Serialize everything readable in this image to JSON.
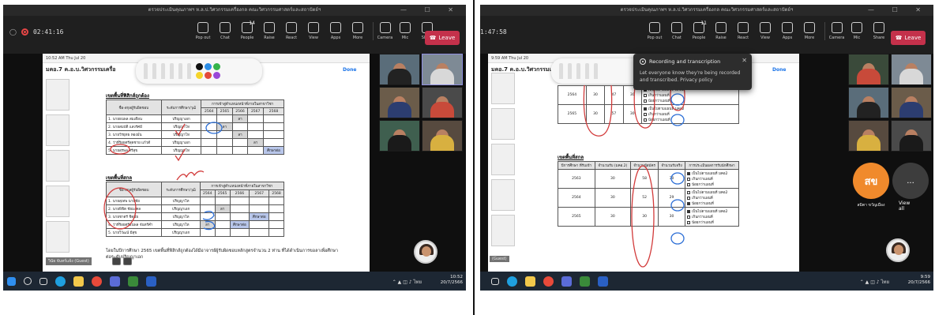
{
  "left": {
    "window_title": "ตรวจประเมินคุณภาพฯ ห.ล.ป.วิศวกรรมเครื่องกล คณะวิศวกรรมศาสตร์และสถาปัตย์ฯ",
    "timer": "02:41:16",
    "toolbar": [
      {
        "label": "Pop out",
        "icon": "pop-out-icon"
      },
      {
        "label": "Chat",
        "icon": "chat-icon"
      },
      {
        "label": "People",
        "icon": "people-icon",
        "badge": "14"
      },
      {
        "label": "Raise",
        "icon": "raise-hand-icon"
      },
      {
        "label": "React",
        "icon": "react-icon"
      },
      {
        "label": "View",
        "icon": "view-icon"
      },
      {
        "label": "Apps",
        "icon": "apps-icon"
      },
      {
        "label": "More",
        "icon": "more-icon"
      },
      {
        "label": "Camera",
        "icon": "camera-icon"
      },
      {
        "label": "Mic",
        "icon": "mic-icon"
      },
      {
        "label": "Share",
        "icon": "share-icon"
      }
    ],
    "leave_label": "Leave",
    "ipad_status": "10:52 AM  Thu Jul 20",
    "doc_title": "มคอ.7 ค.อ.บ.วิศวกรรมเครื่อ",
    "done_label": "Done",
    "section1_title": "เขตพื้นที่ฟิสิกส์ถูกต้อง",
    "section2_title": "เขตพื้นที่สกล",
    "table_headers": {
      "col1": "ชื่อ-สกุลผู้รับผิดชอบ",
      "col2": "ระดับการศึกษา/วุฒิ",
      "col3": "การเข้าสู่ตำแหน่งหน้าที่ภายในสาขาวิชา",
      "years": [
        "2564",
        "2565",
        "2566",
        "2567",
        "2568"
      ]
    },
    "table1_rows": [
      {
        "name": "1. นายธนพล สมเดือน",
        "level": "ปริญญาเอก",
        "cells": [
          "",
          "",
          "ลา",
          "",
          ""
        ]
      },
      {
        "name": "2. นายสมบัติ แสงรัศมี",
        "level": "ปริญญาโท",
        "cells": [
          "",
          "ลา",
          "",
          "",
          ""
        ]
      },
      {
        "name": "3. นายวีรยุทธ ทองมั่น",
        "level": "ปริญญาโท",
        "cells": [
          "",
          "",
          "ลา",
          "",
          ""
        ]
      },
      {
        "name": "4. ว่าที่ร้อยตรีสุดชาย แก้วดี",
        "level": "ปริญญาเอก",
        "cells": [
          "",
          "",
          "",
          "ลา",
          ""
        ]
      },
      {
        "name": "5. นายสุรพล ศรีสุข",
        "level": "ปริญญาโท",
        "cells": [
          "",
          "",
          "",
          "",
          "ศึกษาต่อ"
        ]
      }
    ],
    "table2_rows": [
      {
        "name": "1. นายสุเทพ นามชัย",
        "level": "ปริญญาโท",
        "cells": [
          "",
          "",
          "",
          "",
          ""
        ]
      },
      {
        "name": "2. นายพิชิต ชัยมงคล",
        "level": "ปริญญาเอก",
        "cells": [
          "",
          "ลา",
          "",
          "",
          ""
        ]
      },
      {
        "name": "3. นายชาตรี ชิดชัย",
        "level": "ปริญญาโท",
        "cells": [
          "",
          "",
          "",
          "ศึกษาต่อ",
          ""
        ]
      },
      {
        "name": "4. ว่าที่ร้อยตรีธนพล จันทร์คำ",
        "level": "ปริญญาโท",
        "cells": [
          "ลา",
          "",
          "ศึกษาต่อ",
          "",
          ""
        ]
      },
      {
        "name": "5. นายวิวัฒน์ มีสุข",
        "level": "ปริญญาเอก",
        "cells": [
          "",
          "",
          "",
          "",
          ""
        ]
      }
    ],
    "paragraph": "โดยในปีการศึกษา 2565 เขตพื้นที่ฟิสิกส์ถูกต้องได้มีอาจารย์ผู้รับผิดชอบหลักสูตรจำนวน 2 ท่าน ที่ได้ดำเนินการขอลาเพื่อศึกษาต่อระดับปริญญาเอก",
    "guest_label": "วินัย จันทร์แจ้ง (Guest)",
    "clock_time": "10:52",
    "clock_date": "20/7/2566"
  },
  "right": {
    "window_title": "ตรวจประเมินคุณภาพฯ ห.ล.ป.วิศวกรรมเครื่องกล คณะวิศวกรรมศาสตร์และสถาปัตย์ฯ",
    "timer": "1:47:58",
    "toolbar": [
      {
        "label": "Pop out",
        "icon": "pop-out-icon"
      },
      {
        "label": "Chat",
        "icon": "chat-icon"
      },
      {
        "label": "People",
        "icon": "people-icon",
        "badge": "11"
      },
      {
        "label": "Raise",
        "icon": "raise-hand-icon"
      },
      {
        "label": "React",
        "icon": "react-icon"
      },
      {
        "label": "View",
        "icon": "view-icon"
      },
      {
        "label": "Apps",
        "icon": "apps-icon"
      },
      {
        "label": "More",
        "icon": "more-icon"
      },
      {
        "label": "Camera",
        "icon": "camera-icon"
      },
      {
        "label": "Mic",
        "icon": "mic-icon"
      },
      {
        "label": "Share",
        "icon": "share-icon"
      }
    ],
    "leave_label": "Leave",
    "ipad_status": "9:59 AM  Thu Jul 20",
    "doc_title": "มคอ.7 ค.อ.บ.วิศวกรรมเครื่อ",
    "done_label": "Done",
    "popup": {
      "title": "Recording and transcription",
      "text": "Let everyone know they're being recorded and transcribed. Privacy policy"
    },
    "upper_rows": [
      {
        "year": "2564",
        "plan": "30",
        "actual": "47",
        "admit": "30",
        "checks": [
          "เป็นไปตามแผนที่ มคอ2",
          "เกินกว่าแผนที่",
          "น้อยกว่าแผนที่"
        ],
        "checked": 0
      },
      {
        "year": "2565",
        "plan": "30",
        "actual": "57",
        "admit": "30",
        "checks": [
          "เป็นไปตามแผนที่ มคอ2",
          "เกินกว่าแผนที่",
          "น้อยกว่าแผนที่"
        ],
        "checked": 0
      }
    ],
    "section_title": "เขตพื้นที่สกล",
    "table_headers": [
      "ปีการศึกษา ที่รับเข้า",
      "จำนวนรับ (มคอ.2)",
      "จำนวนผู้สมัคร",
      "จำนวนรับจริง",
      "การประเมินผลการรับนักศึกษา"
    ],
    "lower_rows": [
      {
        "year": "2563",
        "plan": "30",
        "actual": "58",
        "admit": "30",
        "checks": [
          "เป็นไปตามแผนที่ มคอ2",
          "เกินกว่าแผนที่",
          "น้อยกว่าแผนที่"
        ],
        "checked": 0
      },
      {
        "year": "2564",
        "plan": "30",
        "actual": "52",
        "admit": "29",
        "checks": [
          "เป็นไปตามแผนที่ มคอ2",
          "เกินกว่าแผนที่",
          "น้อยกว่าแผนที่"
        ],
        "checked": 2
      },
      {
        "year": "2565",
        "plan": "30",
        "actual": "30",
        "admit": "30",
        "checks": [
          "เป็นไปตามแผนที่ มคอ2",
          "เกินกว่าแผนที่",
          "น้อยกว่าแผนที่"
        ],
        "checked": 0
      }
    ],
    "avatar_initials": "สข",
    "avatar_name": "สมิตา ขวัญเมือง",
    "more_label": "...",
    "view_all_label": "View all",
    "guest_label": "(Guest)",
    "clock_time": "9:59",
    "clock_date": "20/7/2566"
  },
  "colors": {
    "leave": "#c4314b",
    "taskbar": "#1d2733",
    "annotation_red": "#d23a3a",
    "annotation_blue": "#2d6fd6",
    "avatar": "#f08a2c"
  }
}
